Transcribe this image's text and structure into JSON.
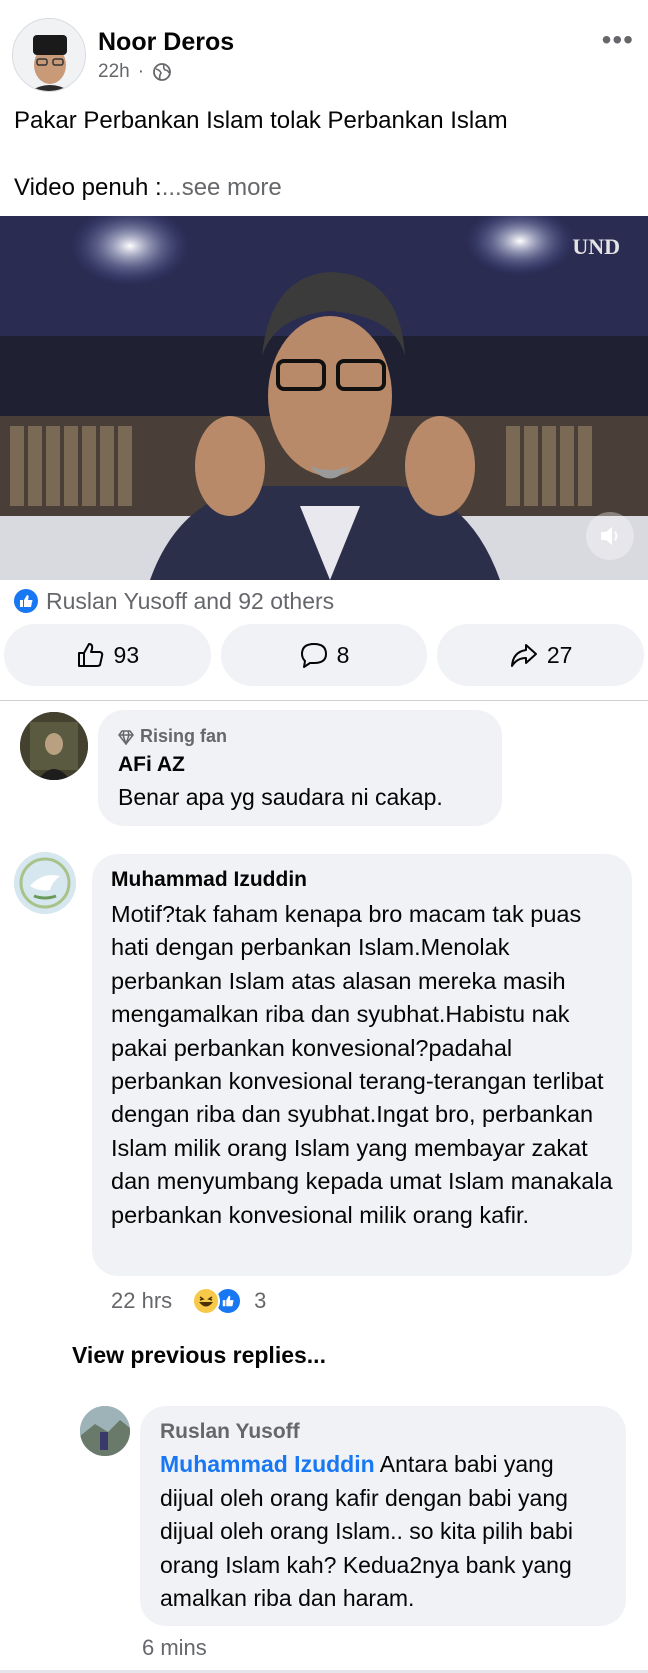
{
  "post": {
    "author": "Noor Deros",
    "time": "22h",
    "separator": "·",
    "text": "Pakar Perbankan Islam tolak Perbankan Islam",
    "text2": "Video penuh :",
    "see_more": "...see more",
    "video_watermark": "UND",
    "reactions_text": "Ruslan Yusoff and 92 others",
    "like_count": "93",
    "comment_count": "8",
    "share_count": "27"
  },
  "comments": [
    {
      "badge": "Rising fan",
      "name": "AFi AZ",
      "text": "Benar apa yg saudara ni cakap."
    },
    {
      "name": "Muhammad Izuddin",
      "text": "Motif?tak faham kenapa bro macam tak puas hati dengan perbankan Islam.Menolak perbankan Islam atas alasan mereka masih mengamalkan riba dan syubhat.Habistu nak pakai perbankan konvesional?padahal perbankan konvesional terang-terangan terlibat dengan riba dan syubhat.Ingat bro, perbankan Islam milik orang Islam yang membayar zakat dan menyumbang kepada umat Islam manakala perbankan konvesional milik orang kafir.",
      "time": "22 hrs",
      "reaction_count": "3"
    }
  ],
  "view_previous": "View previous replies...",
  "reply": {
    "name": "Ruslan Yusoff",
    "mention": "Muhammad Izuddin",
    "text": " Antara babi yang dijual oleh orang kafir dengan babi yang dijual oleh orang Islam.. so kita pilih babi orang Islam kah? Kedua2nya bank yang amalkan riba dan haram.",
    "time": "6 mins"
  },
  "colors": {
    "accent": "#1877f2",
    "bubble": "#f0f2f5",
    "muted": "#65676b"
  }
}
